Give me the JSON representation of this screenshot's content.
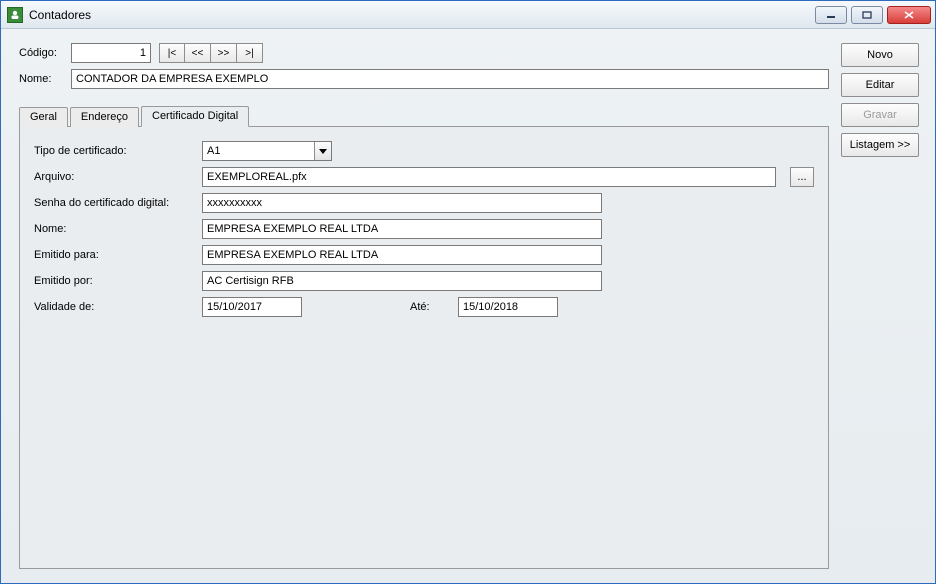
{
  "window": {
    "title": "Contadores"
  },
  "header": {
    "codigo_label": "Código:",
    "codigo_value": "1",
    "nome_label": "Nome:",
    "nome_value": "CONTADOR DA EMPRESA EXEMPLO",
    "nav": {
      "first": "|<",
      "prev": "<<",
      "next": ">>",
      "last": ">|"
    }
  },
  "tabs": {
    "geral": "Geral",
    "endereco": "Endereço",
    "cert": "Certificado Digital"
  },
  "cert": {
    "tipo_label": "Tipo de certificado:",
    "tipo_value": "A1",
    "arquivo_label": "Arquivo:",
    "arquivo_value": "EXEMPLOREAL.pfx",
    "browse": "...",
    "senha_label": "Senha do certificado digital:",
    "senha_value": "xxxxxxxxxx",
    "nome_label": "Nome:",
    "nome_value": "EMPRESA EXEMPLO REAL LTDA",
    "emitido_para_label": "Emitido para:",
    "emitido_para_value": "EMPRESA EXEMPLO REAL LTDA",
    "emitido_por_label": "Emitido por:",
    "emitido_por_value": "AC Certisign RFB",
    "validade_de_label": "Validade de:",
    "validade_de_value": "15/10/2017",
    "validade_ate_label": "Até:",
    "validade_ate_value": "15/10/2018"
  },
  "side": {
    "novo": "Novo",
    "editar": "Editar",
    "gravar": "Gravar",
    "listagem": "Listagem >>"
  }
}
